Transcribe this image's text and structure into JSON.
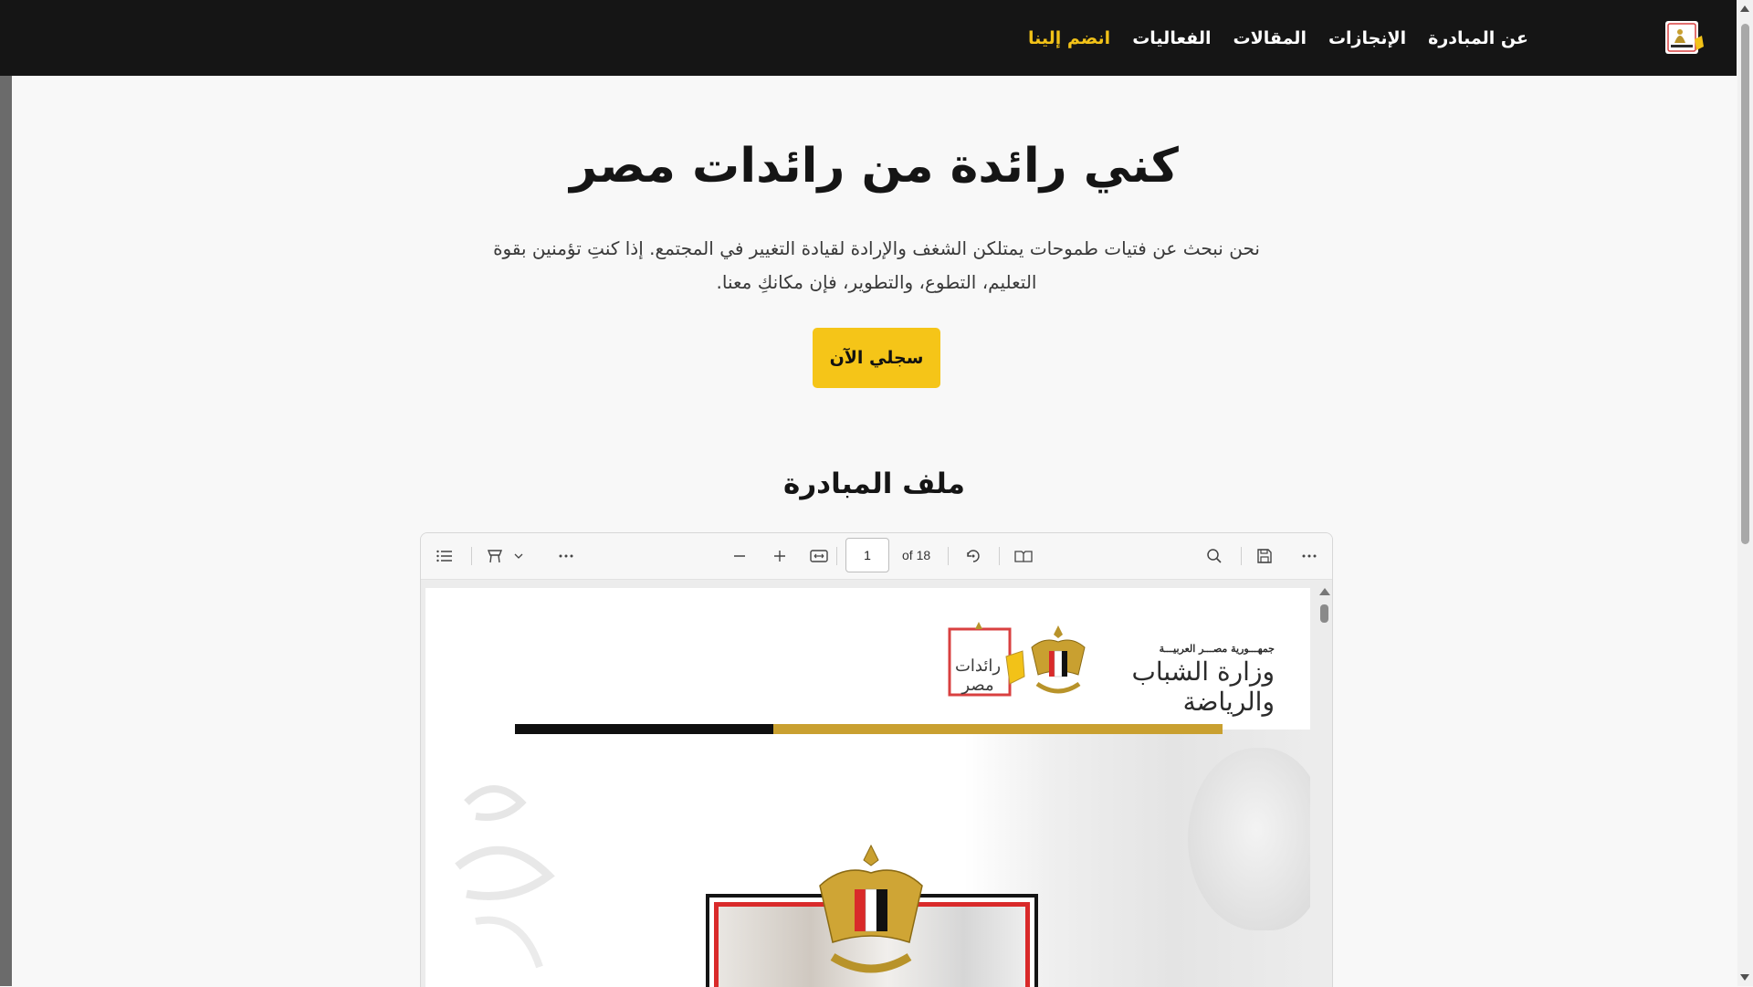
{
  "nav": {
    "logo_icon": "raedat-misr-logo-icon",
    "links": [
      {
        "label": "عن المبادرة"
      },
      {
        "label": "الإنجازات"
      },
      {
        "label": "المقالات"
      },
      {
        "label": "الفعاليات"
      },
      {
        "label": "انضم إلينا"
      }
    ]
  },
  "hero": {
    "title": "كني رائدة من رائدات مصر",
    "description": "نحن نبحث عن فتيات طموحات يمتلكن الشغف والإرادة لقيادة التغيير في المجتمع. إذا كنتِ تؤمنين بقوة التعليم، التطوع، والتطوير، فإن مكانكِ معنا.",
    "cta": "سجلي الآن"
  },
  "section": {
    "title": "ملف المبادرة"
  },
  "pdf_viewer": {
    "page_number": "1",
    "page_total": "of 18",
    "toolbar_icons": [
      "contents-icon",
      "draw-icon",
      "chevron-down-icon",
      "more-icon",
      "zoom-out-icon",
      "zoom-in-icon",
      "fit-width-icon",
      "rotate-icon",
      "page-view-icon",
      "search-icon",
      "save-icon",
      "more-icon"
    ]
  },
  "pdf_page": {
    "ministry_line1": "جمهـــورية مصـــر العربيـــة",
    "ministry_line2": "وزارة الشباب والرياضة",
    "badge_text": "رائدات مصر"
  },
  "colors": {
    "nav_bg": "#151515",
    "accent_yellow": "#f5c518",
    "join_link": "#f2c218",
    "gold_stripe": "#c9a030",
    "frame_red": "#d92a2a"
  }
}
